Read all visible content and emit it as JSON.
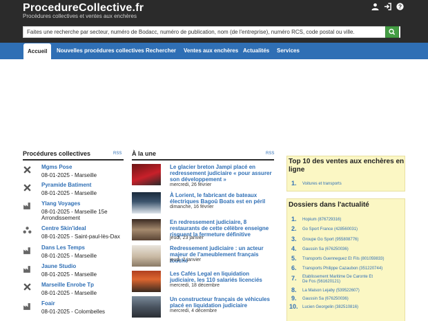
{
  "header": {
    "logo": "ProcedureCollective.fr",
    "tagline": "Procédures collectives et ventes aux enchères",
    "search_placeholder": "Faites une recherche par secteur, numéro de Bodacc, numéro de publication, nom (de l'entreprise), numéro RCS, code postal ou ville."
  },
  "nav": [
    "Accueil",
    "Nouvelles procédures collectives",
    "Rechercher",
    "Ventes aux enchères",
    "Actualités",
    "Services"
  ],
  "procedures": {
    "title": "Procédures collectives",
    "rss": "RSS",
    "items": [
      {
        "name": "Mgms Pose",
        "meta": "08-01-2025 - Marseille",
        "icon": "tools-icon"
      },
      {
        "name": "Pyramide Batiment",
        "meta": "08-01-2025 - Marseille",
        "icon": "tools-icon"
      },
      {
        "name": "Ylang Voyages",
        "meta": "08-01-2025 - Marseille 15e Arrondissement",
        "icon": "factory-icon"
      },
      {
        "name": "Centre Skin'ideal",
        "meta": "08-01-2025 - Saint-paul-lès-Dax",
        "icon": "people-icon"
      },
      {
        "name": "Dans Les Temps",
        "meta": "08-01-2025 - Marseille",
        "icon": "factory-icon"
      },
      {
        "name": "Jaune Studio",
        "meta": "08-01-2025 - Marseille",
        "icon": "factory-icon"
      },
      {
        "name": "Marseille Enrobe Tp",
        "meta": "08-01-2025 - Marseille",
        "icon": "tools-icon"
      },
      {
        "name": "Foair",
        "meta": "08-01-2025 - Colombelles",
        "icon": "factory-icon"
      }
    ]
  },
  "news": {
    "title": "À la une",
    "rss": "RSS",
    "items": [
      {
        "title": "Le glacier breton Jampi placé en redressement judiciaire « pour assurer son développement »",
        "date": "mercredi, 26 février"
      },
      {
        "title": "À Lorient, le fabricant de bateaux électriques Bagoû Boats est en péril",
        "date": "dimanche, 16 février"
      },
      {
        "title": "En redressement judiciaire, 8 restaurants de cette célèbre enseigne risquent la fermeture définitive",
        "date": "jeudi, 23 janvier"
      },
      {
        "title": "Redressement judiciaire : un acteur majeur de l'ameublement français touché",
        "date": "jeudi, 2 janvier"
      },
      {
        "title": "Les Cafés Legal en liquidation judiciaire, les 110 salariés licenciés",
        "date": "mercredi, 18 décembre"
      },
      {
        "title": "Un constructeur français de véhicules placé en liquidation judiciaire",
        "date": "mercredi, 4 décembre"
      }
    ]
  },
  "top10": {
    "title": "Top 10 des ventes aux enchères en ligne",
    "items": [
      {
        "rank": "1.",
        "label": "Voitures et transports"
      }
    ]
  },
  "dossiers": {
    "title": "Dossiers dans l'actualité",
    "items": [
      {
        "rank": "1.",
        "label": "Hopium (876729316)"
      },
      {
        "rank": "2.",
        "label": "Go Sport France (428560031)"
      },
      {
        "rank": "3.",
        "label": "Groupe Go Sport (955808776)"
      },
      {
        "rank": "4.",
        "label": "Gaussin Sa (676250036)"
      },
      {
        "rank": "5.",
        "label": "Transports Guenneguez Et Fils (801059833)"
      },
      {
        "rank": "6.",
        "label": "Transports Philippe Cazaubon (351220744)"
      },
      {
        "rank": "7.",
        "label": "Etablissement Maritime De Caronte Et De Fos (561620121)"
      },
      {
        "rank": "8.",
        "label": "La Maison Lejaby (539522607)"
      },
      {
        "rank": "9.",
        "label": "Gaussin Sa (676250036)"
      },
      {
        "rank": "10.",
        "label": "Lucien Georgelin (382510816)"
      }
    ]
  },
  "colors": {
    "header_bg": "#2b2b2b",
    "nav_bg": "#2f6fb5",
    "link": "#2f6fb5",
    "search_btn": "#449d44",
    "box_bg": "#fbf7c4"
  }
}
